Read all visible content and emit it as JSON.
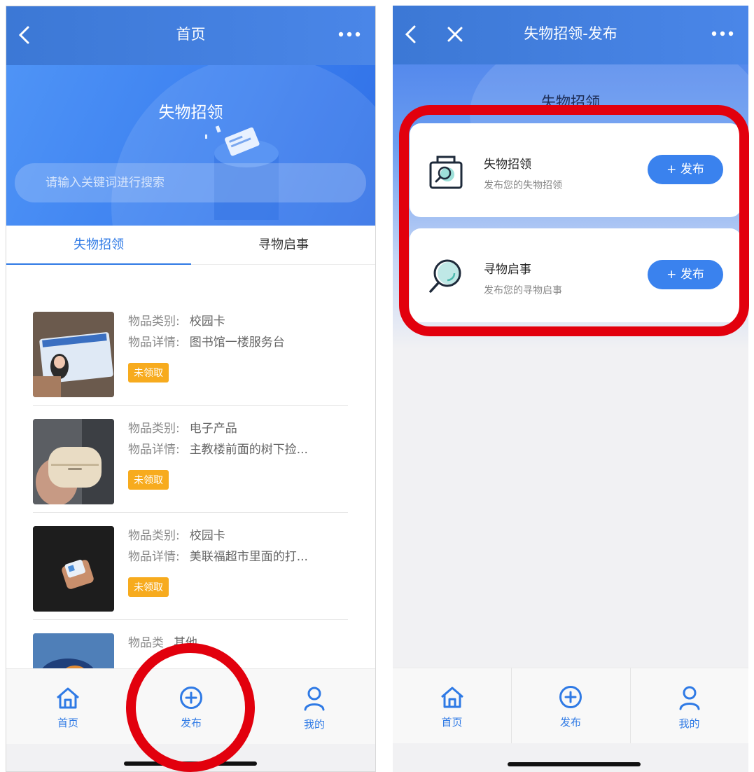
{
  "left": {
    "nav_title": "首页",
    "hero_title": "失物招领",
    "search_placeholder": "请输入关键词进行搜索",
    "tabs": [
      {
        "label": "失物招领",
        "active": true
      },
      {
        "label": "寻物启事",
        "active": false
      }
    ],
    "items": [
      {
        "category_label": "物品类别:",
        "category": "校园卡",
        "detail_label": "物品详情:",
        "detail": "图书馆一楼服务台",
        "status": "未领取"
      },
      {
        "category_label": "物品类别:",
        "category": "电子产品",
        "detail_label": "物品详情:",
        "detail": "主教楼前面的树下捡...",
        "status": "未领取"
      },
      {
        "category_label": "物品类别:",
        "category": "校园卡",
        "detail_label": "物品详情:",
        "detail": "美联福超市里面的打...",
        "status": "未领取"
      },
      {
        "category_label": "物品类",
        "category": "其他"
      }
    ],
    "tabbar": [
      {
        "label": "首页",
        "icon": "home-icon"
      },
      {
        "label": "发布",
        "icon": "plus-circle-icon"
      },
      {
        "label": "我的",
        "icon": "user-icon"
      }
    ]
  },
  "right": {
    "nav_title": "失物招领-发布",
    "hero_title": "失物招领",
    "cards": [
      {
        "title": "失物招领",
        "subtitle": "发布您的失物招领",
        "button": "+ 发布",
        "icon": "lost-bag-icon"
      },
      {
        "title": "寻物启事",
        "subtitle": "发布您的寻物启事",
        "button": "+ 发布",
        "icon": "magnifier-icon"
      }
    ],
    "tabbar": [
      {
        "label": "首页",
        "icon": "home-icon"
      },
      {
        "label": "发布",
        "icon": "plus-circle-icon"
      },
      {
        "label": "我的",
        "icon": "user-icon"
      }
    ]
  },
  "colors": {
    "primary": "#2f7ae5",
    "badge": "#f7ab1e",
    "highlight": "#e2000d"
  }
}
